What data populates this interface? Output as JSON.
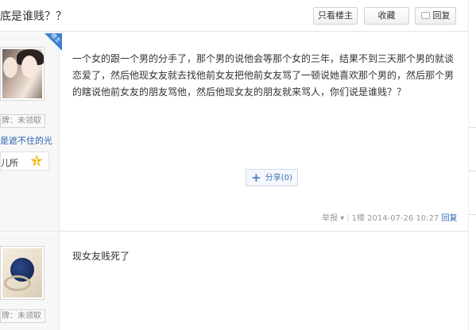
{
  "header": {
    "thread_title": "底是谁贱？？",
    "buttons": {
      "only_op": "只看楼主",
      "favorite": "收藏",
      "reply": "回复"
    }
  },
  "posts": [
    {
      "op_corner": "楼主",
      "badge": "牌：未领取",
      "user_name": "是遮不住的光",
      "level_name": "儿所",
      "level_num": "1",
      "content": "一个女的跟一个男的分手了，那个男的说他会等那个女的三年，结果不到三天那个男的就谈恋爱了，然后他现女友就去找他前女友把他前女友骂了一顿说她喜欢那个男的，然后那个男的瞎说他前女友的朋友骂他，然后他现女友的朋友就来骂人，你们说是谁贱？？",
      "share_label": "分享(0)",
      "meta": {
        "report": "举报",
        "floor": "1楼",
        "time": "2014-07-26 10:27",
        "reply": "回复"
      }
    },
    {
      "badge": "牌：未领取",
      "content": "现女友贱死了"
    }
  ],
  "colors": {
    "link": "#2d64b3",
    "op_corner": "#3d7ed4",
    "star": "#f5b400"
  },
  "icons": [
    "reply-bubble-icon",
    "plus-icon",
    "level-star-icon",
    "dropdown-caret-icon"
  ]
}
